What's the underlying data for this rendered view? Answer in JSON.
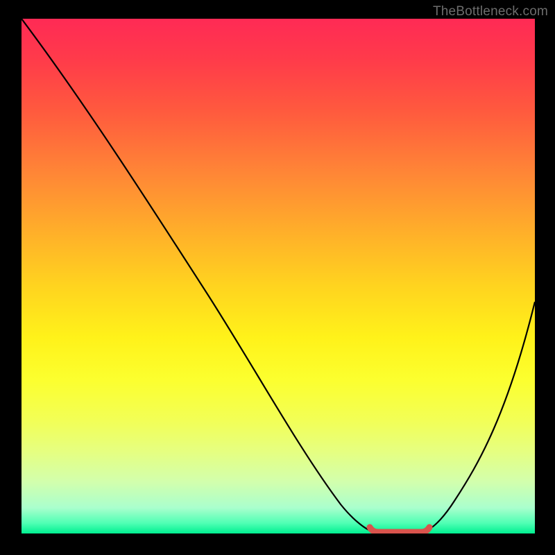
{
  "watermark": "TheBottleneck.com",
  "chart_data": {
    "type": "line",
    "title": "",
    "xlabel": "",
    "ylabel": "",
    "xlim": [
      0,
      100
    ],
    "ylim": [
      0,
      100
    ],
    "series": [
      {
        "name": "curve",
        "x": [
          0,
          6,
          12,
          18,
          24,
          30,
          36,
          42,
          48,
          54,
          57,
          60,
          64,
          68,
          72,
          75,
          78,
          84,
          90,
          96,
          100
        ],
        "y": [
          100,
          93,
          86,
          79,
          72,
          64,
          56,
          47,
          37,
          25,
          18,
          11,
          5,
          1,
          0,
          0,
          0,
          3,
          13,
          30,
          45
        ]
      },
      {
        "name": "optimal-band",
        "x": [
          68,
          72,
          76,
          78.5
        ],
        "y": [
          0.9,
          0.4,
          0.4,
          0.9
        ]
      }
    ],
    "gradient_stops": [
      {
        "pos": 0,
        "color": "#ff2a55"
      },
      {
        "pos": 18,
        "color": "#ff5a3e"
      },
      {
        "pos": 42,
        "color": "#ffb129"
      },
      {
        "pos": 62,
        "color": "#fff21a"
      },
      {
        "pos": 84,
        "color": "#e6ff80"
      },
      {
        "pos": 100,
        "color": "#00f090"
      }
    ],
    "accent_red": "#d9544d",
    "curve_color": "#000000"
  }
}
